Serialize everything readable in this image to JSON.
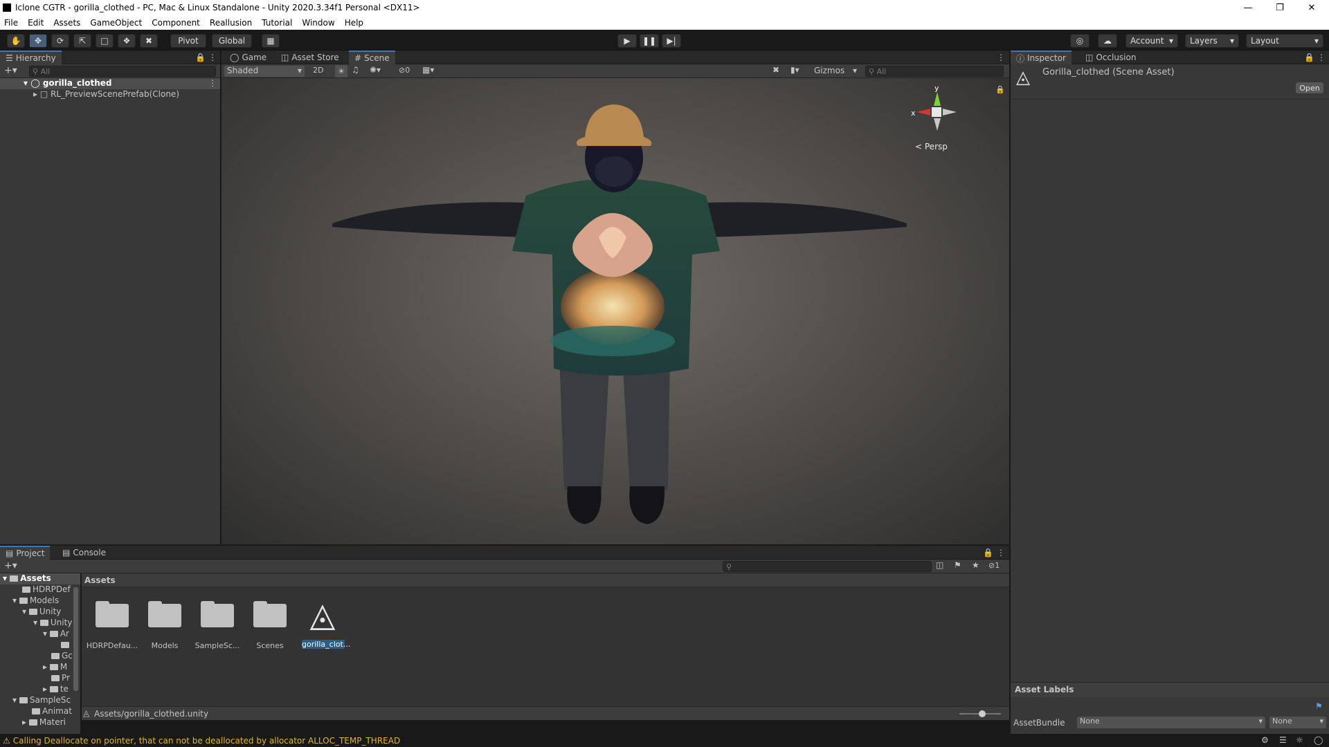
{
  "window": {
    "title": "Iclone CGTR - gorilla_clothed - PC, Mac & Linux Standalone - Unity 2020.3.34f1 Personal <DX11>"
  },
  "menu": [
    "File",
    "Edit",
    "Assets",
    "GameObject",
    "Component",
    "Reallusion",
    "Tutorial",
    "Window",
    "Help"
  ],
  "toolbar": {
    "pivot": "Pivot",
    "global": "Global",
    "account": "Account",
    "layers": "Layers",
    "layout": "Layout"
  },
  "hierarchy": {
    "tab": "Hierarchy",
    "search_placeholder": "All",
    "root": "gorilla_clothed",
    "child": "RL_PreviewScenePrefab(Clone)"
  },
  "scene_tabs": [
    "Game",
    "Asset Store",
    "Scene"
  ],
  "scene_bar": {
    "shading": "Shaded",
    "mode2d": "2D",
    "fx_count": "0",
    "gizmos": "Gizmos",
    "search_placeholder": "All"
  },
  "gizmo": {
    "y": "y",
    "x": "x",
    "persp": "Persp"
  },
  "inspector": {
    "tab": "Inspector",
    "tab2": "Occlusion",
    "asset_title": "Gorilla_clothed (Scene Asset)",
    "open_button": "Open",
    "asset_labels": "Asset Labels",
    "assetbundle_label": "AssetBundle",
    "assetbundle_value": "None",
    "variant_value": "None"
  },
  "project": {
    "tab": "Project",
    "tab2": "Console",
    "breadcrumb": "Assets",
    "hidden_count": "1",
    "path": "Assets/gorilla_clothed.unity",
    "tree": [
      "Assets",
      "HDRPDef",
      "Models",
      "Unity",
      "Unity",
      "Ar",
      "",
      "Gc",
      "M",
      "Pr",
      "te",
      "SampleSc",
      "Animat",
      "Materi"
    ],
    "items": [
      "HDRPDefau...",
      "Models",
      "SampleSc...",
      "Scenes",
      "gorilla_clot..."
    ]
  },
  "status": {
    "message": "Calling Deallocate on pointer, that can not be deallocated by allocator ALLOC_TEMP_THREAD"
  },
  "colors": {
    "accent": "#3a79bb",
    "selection": "#2c5d87",
    "warning": "#e2b43b"
  }
}
